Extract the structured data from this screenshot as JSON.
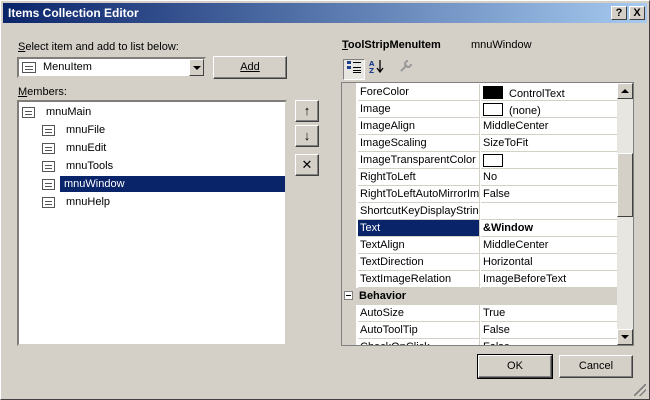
{
  "window": {
    "title": "Items Collection Editor",
    "help_label": "?",
    "close_label": "X"
  },
  "left": {
    "select_label_pre": "",
    "select_label_accel": "S",
    "select_label_post": "elect item and add to list below:",
    "combo_value": "MenuItem",
    "add_label": "Add",
    "members_label_accel": "M",
    "members_label_post": "embers:"
  },
  "tree": {
    "root": "mnuMain",
    "children": [
      "mnuFile",
      "mnuEdit",
      "mnuTools",
      "mnuWindow",
      "mnuHelp"
    ],
    "selected": "mnuWindow"
  },
  "side_buttons": {
    "up": "↑",
    "down": "↓",
    "delete": "✕"
  },
  "props": {
    "type_accel": "T",
    "type_post": "oolStripMenuItem",
    "object_name": "mnuWindow",
    "categorized_icon": "categorized-icon",
    "alphabetical_icon": "alphabetical-icon",
    "property_pages_icon": "wrench-icon",
    "rows": [
      {
        "name": "ForeColor",
        "value": "ControlText",
        "swatch": "#000000"
      },
      {
        "name": "Image",
        "value": "(none)",
        "swatch": "#ffffff"
      },
      {
        "name": "ImageAlign",
        "value": "MiddleCenter"
      },
      {
        "name": "ImageScaling",
        "value": "SizeToFit"
      },
      {
        "name": "ImageTransparentColor",
        "value": "",
        "swatch": "#ffffff"
      },
      {
        "name": "RightToLeft",
        "value": "No"
      },
      {
        "name": "RightToLeftAutoMirrorIm",
        "value": "False"
      },
      {
        "name": "ShortcutKeyDisplayString",
        "value": ""
      },
      {
        "name": "Text",
        "value": "&Window",
        "selected": true
      },
      {
        "name": "TextAlign",
        "value": "MiddleCenter"
      },
      {
        "name": "TextDirection",
        "value": "Horizontal"
      },
      {
        "name": "TextImageRelation",
        "value": "ImageBeforeText"
      },
      {
        "category": "Behavior"
      },
      {
        "name": "AutoSize",
        "value": "True"
      },
      {
        "name": "AutoToolTip",
        "value": "False"
      },
      {
        "name": "CheckOnClick",
        "value": "False"
      }
    ]
  },
  "footer": {
    "ok_label": "OK",
    "cancel_label": "Cancel"
  }
}
